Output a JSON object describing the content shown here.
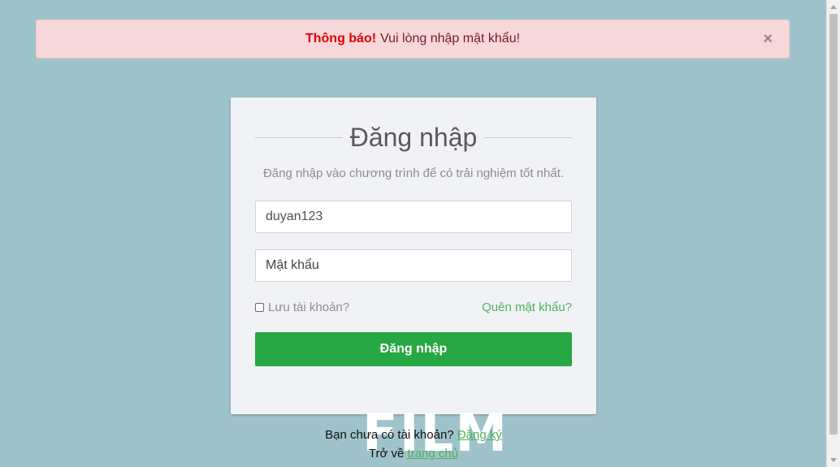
{
  "alert": {
    "label": "Thông báo!",
    "message": "Vui lòng nhập mật khẩu!",
    "close_glyph": "×"
  },
  "login": {
    "title": "Đăng nhập",
    "subtitle": "Đăng nhập vào chương trình để có trải nghiệm tốt nhất.",
    "username_value": "duyan123",
    "password_placeholder": "Mật khẩu",
    "remember_label": "Lưu tài khoản?",
    "forgot_label": "Quên mật khẩu?",
    "submit_label": "Đăng nhập"
  },
  "footer": {
    "no_account_text": "Bạn chưa có tài khoản?",
    "register_link": "Đăng ký",
    "back_text": "Trở về",
    "home_link": "trang chủ",
    "watermark_logo": "FILM"
  },
  "colors": {
    "background": "#9fc3cb",
    "alert_bg": "#f8d7da",
    "alert_label": "#e00000",
    "primary_button": "#28a745",
    "link": "#4bb35b"
  }
}
